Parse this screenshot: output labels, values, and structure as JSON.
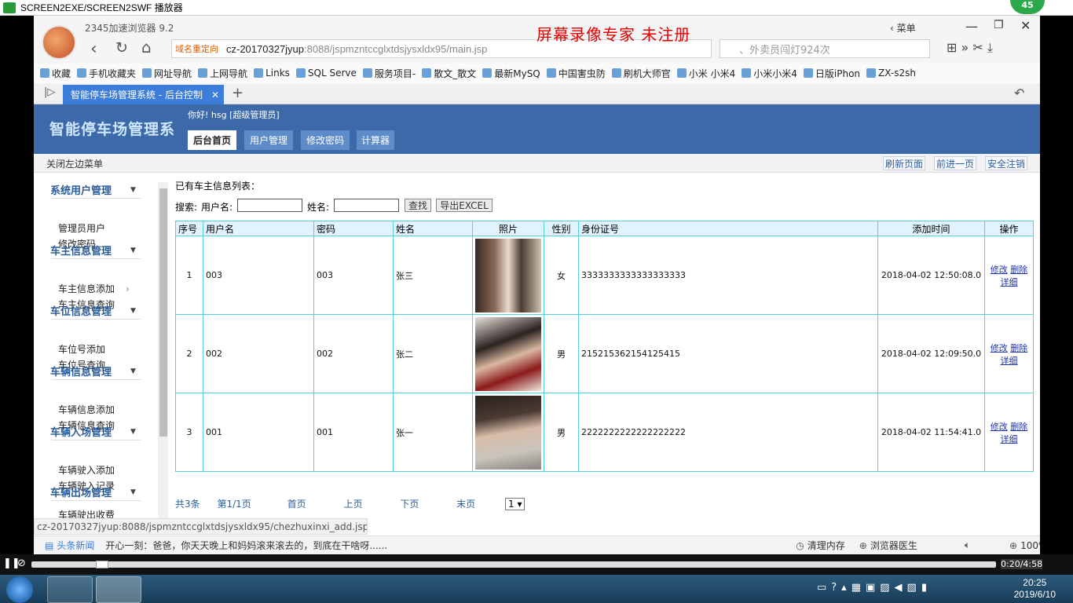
{
  "player": {
    "title": "SCREEN2EXE/SCREEN2SWF 播放器",
    "time": "0:20/4:58",
    "badge": "45"
  },
  "browser": {
    "name": "2345加速浏览器 9.2",
    "watermark": "屏幕录像专家  未注册",
    "menu": "菜单",
    "redirect": "域名重定向",
    "url_host": "cz-20170327jyup",
    "url_path": ":8088/jspmzntccglxtdsjysxldx95/main.jsp",
    "search": "、外卖员闯灯924次",
    "bookmarks": [
      "收藏",
      "手机收藏夹",
      "网址导航",
      "上网导航",
      "Links",
      "SQL Serve",
      "服务项目-",
      "散文_散文",
      "最新MySQ",
      "中国害虫防",
      "刷机大师官",
      "小米 小米4",
      "小米小米4",
      "日版iPhon",
      "ZX-s2sh"
    ],
    "tab_title": "智能停车场管理系统 - 后台控制",
    "status_url": "cz-20170327jyup:8088/jspmzntccglxtdsjysxldx95/chezhuxinxi_add.jsp",
    "news_label": "头条新闻",
    "news_text": "开心一刻：爸爸，你天天晚上和妈妈滚来滚去的，到底在干啥呀......",
    "clean_mem": "清理内存",
    "doctor": "浏览器医生",
    "zoom": "100%"
  },
  "app": {
    "system_name": "智能停车场管理系",
    "greeting": "你好! hsg [超级管理员]",
    "nav": [
      "后台首页",
      "用户管理",
      "修改密码",
      "计算器"
    ],
    "close_menu": "关闭左边菜单",
    "actions": [
      "刷新页面",
      "前进一页",
      "安全注销"
    ],
    "sidebar": [
      {
        "title": "系统用户管理",
        "items": [
          "管理员用户",
          "修改密码"
        ]
      },
      {
        "title": "车主信息管理",
        "items": [
          "车主信息添加",
          "车主信息查询"
        ]
      },
      {
        "title": "车位信息管理",
        "items": [
          "车位号添加",
          "车位号查询"
        ]
      },
      {
        "title": "车辆信息管理",
        "items": [
          "车辆信息添加",
          "车辆信息查询"
        ]
      },
      {
        "title": "车辆入场管理",
        "items": [
          "车辆驶入添加",
          "车辆驶入记录"
        ]
      },
      {
        "title": "车辆出场管理",
        "items": [
          "车辆驶出收费"
        ]
      }
    ],
    "list_title": "已有车主信息列表：",
    "search": {
      "label": "搜索:",
      "username_label": "用户名:",
      "name_label": "姓名:",
      "find": "查找",
      "export": "导出EXCEL"
    },
    "table": {
      "headers": [
        "序号",
        "用户名",
        "密码",
        "姓名",
        "照片",
        "性别",
        "身份证号",
        "添加时间",
        "操作"
      ],
      "rows": [
        {
          "no": "1",
          "username": "003",
          "password": "003",
          "name": "张三",
          "gender": "女",
          "id": "3333333333333333333",
          "time": "2018-04-02 12:50:08.0"
        },
        {
          "no": "2",
          "username": "002",
          "password": "002",
          "name": "张二",
          "gender": "男",
          "id": "215215362154125415",
          "time": "2018-04-02 12:09:50.0"
        },
        {
          "no": "3",
          "username": "001",
          "password": "001",
          "name": "张一",
          "gender": "男",
          "id": "2222222222222222222",
          "time": "2018-04-02 11:54:41.0"
        }
      ],
      "op_edit": "修改",
      "op_delete": "删除",
      "op_detail": "详细"
    },
    "pager": {
      "total": "共3条",
      "page": "第1/1页",
      "first": "首页",
      "prev": "上页",
      "next": "下页",
      "last": "末页",
      "current": "1"
    }
  },
  "taskbar": {
    "time": "20:25",
    "date": "2019/6/10"
  },
  "colors": {
    "header": "#3c6aa8",
    "table_border": "#55d0dc",
    "watermark": "#e30000"
  }
}
